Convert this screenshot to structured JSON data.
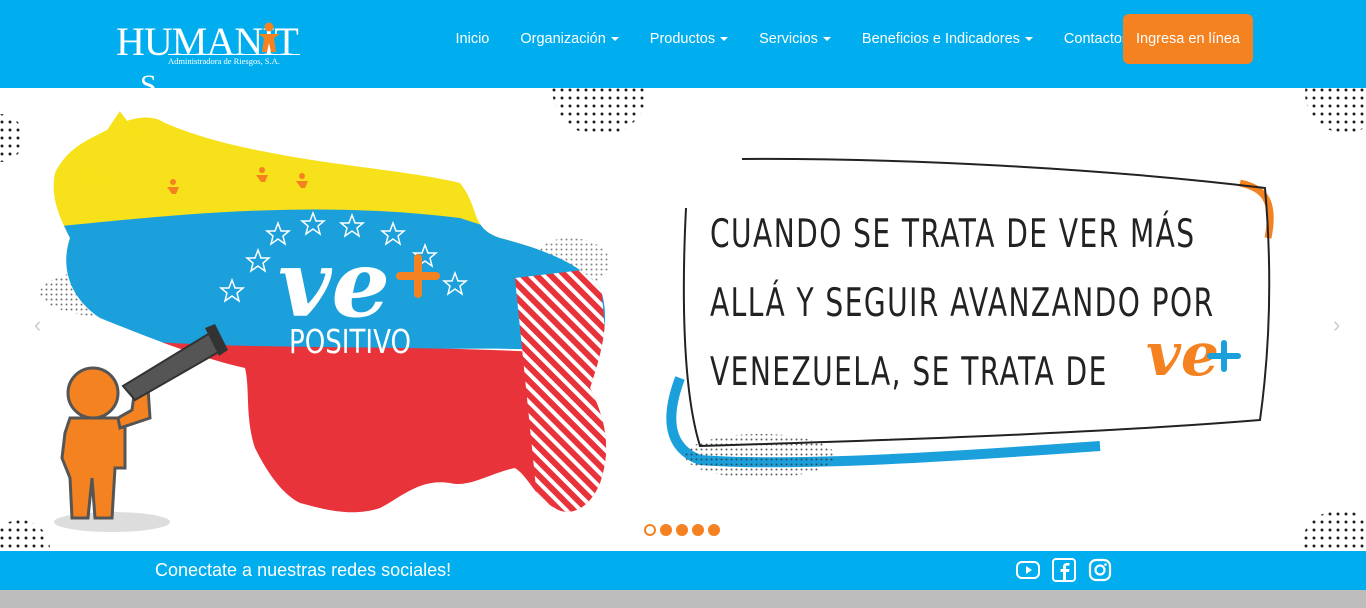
{
  "brand": {
    "name_big": "HUMANIT",
    "name_end": "S",
    "subtitle": "Administradora de Riesgos, S.A.",
    "tagline_logo": "VE+"
  },
  "nav": {
    "items": [
      {
        "label": "Inicio",
        "dropdown": false
      },
      {
        "label": "Organización",
        "dropdown": true
      },
      {
        "label": "Productos",
        "dropdown": true
      },
      {
        "label": "Servicios",
        "dropdown": true
      },
      {
        "label": "Beneficios e Indicadores",
        "dropdown": true
      },
      {
        "label": "Contactos",
        "dropdown": false
      }
    ],
    "cta_label": "Ingresa en línea"
  },
  "hero": {
    "map_logo_main": "ve",
    "map_logo_sub": "POSITIVO",
    "quote_lines": [
      "CUANDO SE TRATA DE VER MÁS",
      "ALLÁ Y SEGUIR AVANZANDO POR",
      "VENEZUELA, SE TRATA DE"
    ],
    "quote_logo": "ve",
    "prev_arrow": "‹",
    "next_arrow": "›",
    "slides": {
      "count": 5,
      "active": 1
    }
  },
  "social": {
    "text": "Conectate a nuestras redes sociales!",
    "icons": [
      "youtube-icon",
      "facebook-icon",
      "instagram-icon"
    ]
  },
  "colors": {
    "primary_blue": "#00aeef",
    "orange": "#f58220",
    "yellow": "#f7e11a",
    "red": "#e8333a",
    "blue_map": "#1ba0dc"
  }
}
